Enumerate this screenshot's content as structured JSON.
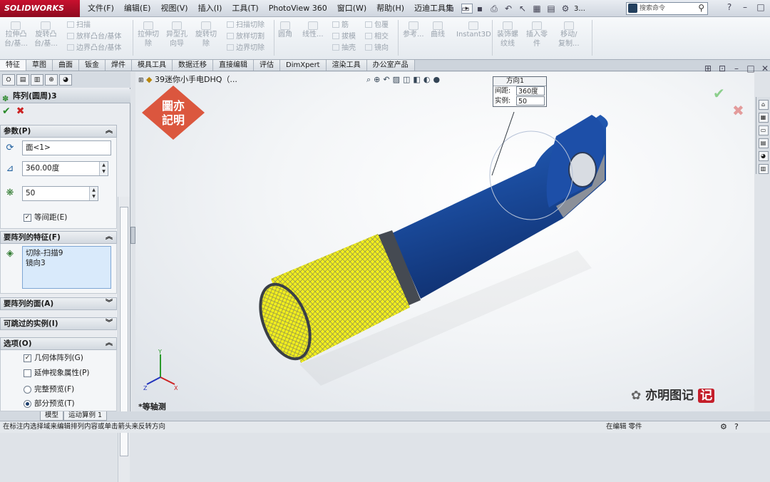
{
  "app": {
    "logo_text": "SOLIDWORKS"
  },
  "menu": [
    "文件(F)",
    "编辑(E)",
    "视图(V)",
    "插入(I)",
    "工具(T)",
    "PhotoView 360",
    "窗口(W)",
    "帮助(H)",
    "迈迪工具集"
  ],
  "quick": {
    "tail_text": "3..."
  },
  "search": {
    "placeholder": "搜索命令"
  },
  "ribbon": {
    "big": [
      {
        "label": "拉伸凸\n台/基..."
      },
      {
        "label": "旋转凸\n台/基..."
      },
      {
        "label": "拉伸切\n除"
      },
      {
        "label": "异型孔\n向导"
      },
      {
        "label": "旋转切\n除"
      },
      {
        "label": "圆角"
      },
      {
        "label": "线性..."
      },
      {
        "label": "参考..."
      },
      {
        "label": "曲线"
      },
      {
        "label": "Instant3D"
      },
      {
        "label": "装饰螺\n纹线"
      },
      {
        "label": "插入零\n件"
      },
      {
        "label": "移动/\n复制..."
      }
    ],
    "small": [
      "扫描",
      "放样凸台/基体",
      "边界凸台/基体",
      "扫描切除",
      "放样切割",
      "边界切除",
      "筋",
      "拔模",
      "抽壳",
      "包覆",
      "相交",
      "镜向"
    ]
  },
  "tabs": [
    "特征",
    "草图",
    "曲面",
    "钣金",
    "焊件",
    "模具工具",
    "数据迁移",
    "直接编辑",
    "评估",
    "DimXpert",
    "渲染工具",
    "办公室产品"
  ],
  "panel": {
    "title": "阵列(圆周)3",
    "params": {
      "header": "参数(P)",
      "face": "面<1>",
      "angle": "360.00度",
      "count": "50",
      "equal_spacing": "等间距(E)"
    },
    "features": {
      "header": "要阵列的特征(F)",
      "items": [
        "切除-扫描9",
        "镜向3"
      ]
    },
    "faces_header": "要阵列的面(A)",
    "skip_header": "可跳过的实例(I)",
    "options": {
      "header": "选项(O)",
      "geometry": "几何体阵列(G)",
      "propagate": "延伸视象属性(P)",
      "full_preview": "完整预览(F)",
      "partial_preview": "部分预览(T)"
    }
  },
  "viewport": {
    "tree_node": "39迷你小手电DHQ（...",
    "view_name": "*等轴测",
    "callout": {
      "title": "方向1",
      "spacing_label": "间距:",
      "spacing_value": "360度",
      "instances_label": "实例:",
      "instances_value": "50"
    },
    "watermark": [
      "亦明图记",
      "记"
    ]
  },
  "stamp": {
    "text": "图亦记明"
  },
  "bottom_tabs": [
    "模型",
    "运动算例 1"
  ],
  "status": {
    "hint": "在标注内选择域来编辑排列内容或单击箭头来反转方向",
    "mode": "在编辑 零件"
  },
  "colors": {
    "body_blue": "#1c4fa3",
    "knurl_yellow": "#f2ef1c",
    "accent_red": "#c8102e"
  }
}
